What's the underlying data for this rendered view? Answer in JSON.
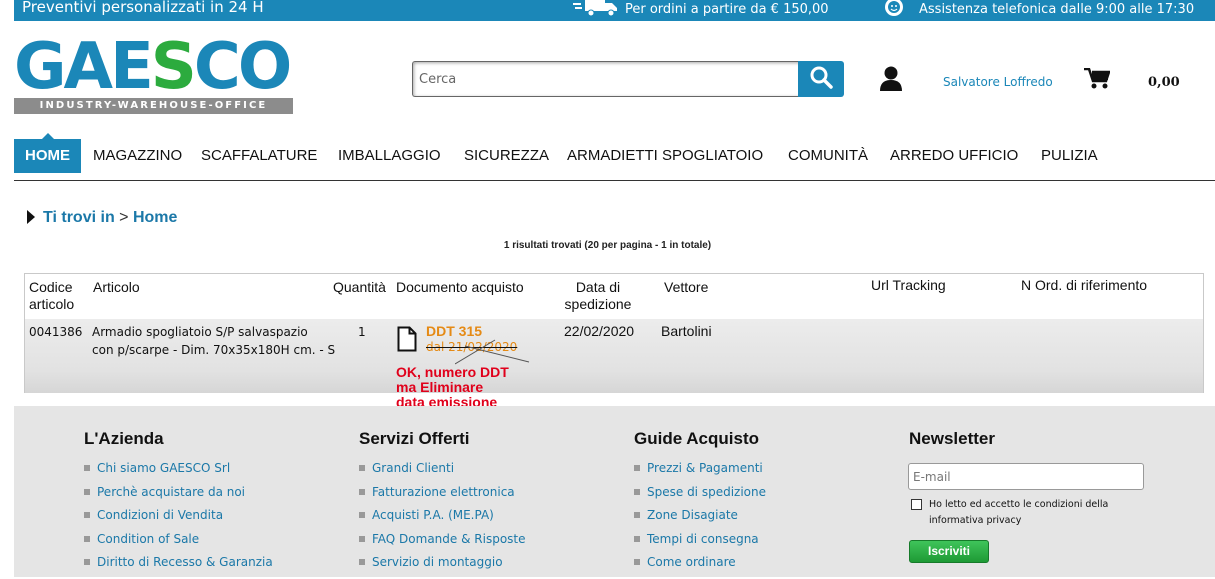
{
  "topbar": {
    "tagline": "Preventivi personalizzati in 24 H",
    "shipping_text": "Per ordini a partire da € 150,00",
    "phone_text": "Assistenza telefonica dalle 9:00 alle 17:30"
  },
  "logo": {
    "word_part1": "GAE",
    "word_s": "S",
    "word_part2": "CO",
    "subtitle": "INDUSTRY-WAREHOUSE-OFFICE"
  },
  "search": {
    "placeholder": "Cerca",
    "icon": "search-icon"
  },
  "user": {
    "name": "Salvatore Loffredo",
    "icon": "user-icon"
  },
  "cart": {
    "total": "0,00",
    "icon": "cart-icon"
  },
  "nav": {
    "items": [
      "HOME",
      "MAGAZZINO",
      "SCAFFALATURE",
      "IMBALLAGGIO",
      "SICUREZZA",
      "ARMADIETTI SPOGLIATOIO",
      "COMUNITÀ",
      "ARREDO UFFICIO",
      "PULIZIA"
    ],
    "active": "HOME"
  },
  "breadcrumb": {
    "prefix": "Ti trovi in",
    "separator": ">",
    "current": "Home"
  },
  "results_text": "1 risultati trovati (20 per pagina - 1 in totale)",
  "table": {
    "headers": {
      "codice_line1": "Codice",
      "codice_line2": "articolo",
      "articolo": "Articolo",
      "quantita": "Quantità",
      "documento": "Documento acquisto",
      "data_line1": "Data di",
      "data_line2": "spedizione",
      "vettore": "Vettore",
      "url": "Url Tracking",
      "nord": "N Ord. di riferimento"
    },
    "row": {
      "codice": "0041386",
      "articolo_line1": "Armadio spogliatoio S/P salvaspazio",
      "articolo_line2": "con p/scarpe - Dim. 70x35x180H cm. - S",
      "quantita": "1",
      "ddt_number": "DDT 315",
      "ddt_date": "dal 21/02/2020",
      "data_spedizione": "22/02/2020",
      "vettore": "Bartolini"
    }
  },
  "annotation": {
    "line1": "OK, numero DDT",
    "line2": "ma Eliminare",
    "line3": "data emissione"
  },
  "footer": {
    "azienda": {
      "title": "L'Azienda",
      "links": [
        "Chi siamo GAESCO Srl",
        "Perchè acquistare da noi",
        "Condizioni di Vendita",
        "Condition of Sale",
        "Diritto di Recesso & Garanzia"
      ]
    },
    "servizi": {
      "title": "Servizi Offerti",
      "links": [
        "Grandi Clienti",
        "Fatturazione elettronica",
        "Acquisti P.A. (ME.PA)",
        "FAQ Domande & Risposte",
        "Servizio di montaggio"
      ]
    },
    "guide": {
      "title": "Guide Acquisto",
      "links": [
        "Prezzi & Pagamenti",
        "Spese di spedizione",
        "Zone Disagiate",
        "Tempi di consegna",
        "Come ordinare"
      ]
    },
    "newsletter": {
      "title": "Newsletter",
      "email_placeholder": "E-mail",
      "privacy_text": "Ho letto ed accetto le condizioni della informativa privacy",
      "subscribe_label": "Iscriviti"
    }
  },
  "colors": {
    "brand_blue": "#1b87b8",
    "brand_green": "#2cab3e",
    "ddt_orange": "#e58a15",
    "note_red": "#e0001b"
  }
}
